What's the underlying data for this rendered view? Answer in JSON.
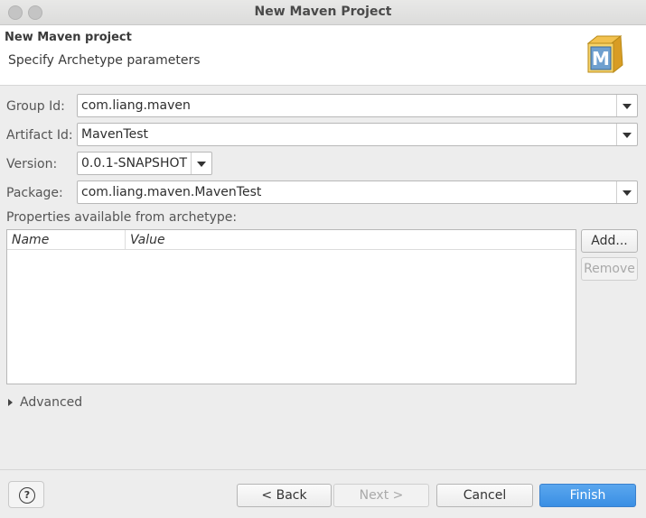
{
  "window": {
    "title": "New Maven Project"
  },
  "header": {
    "title": "New Maven project",
    "subtitle": "Specify Archetype parameters",
    "logo_letter": "M"
  },
  "form": {
    "group_id": {
      "label": "Group Id:",
      "value": "com.liang.maven"
    },
    "artifact_id": {
      "label": "Artifact Id:",
      "value": "MavenTest"
    },
    "version": {
      "label": "Version:",
      "value": "0.0.1-SNAPSHOT"
    },
    "package": {
      "label": "Package:",
      "value": "com.liang.maven.MavenTest"
    }
  },
  "properties": {
    "label": "Properties available from archetype:",
    "columns": [
      "Name",
      "Value"
    ],
    "add_label": "Add...",
    "remove_label": "Remove"
  },
  "advanced": {
    "label": "Advanced"
  },
  "footer": {
    "help_glyph": "?",
    "back_label": "< Back",
    "next_label": "Next >",
    "cancel_label": "Cancel",
    "finish_label": "Finish"
  }
}
